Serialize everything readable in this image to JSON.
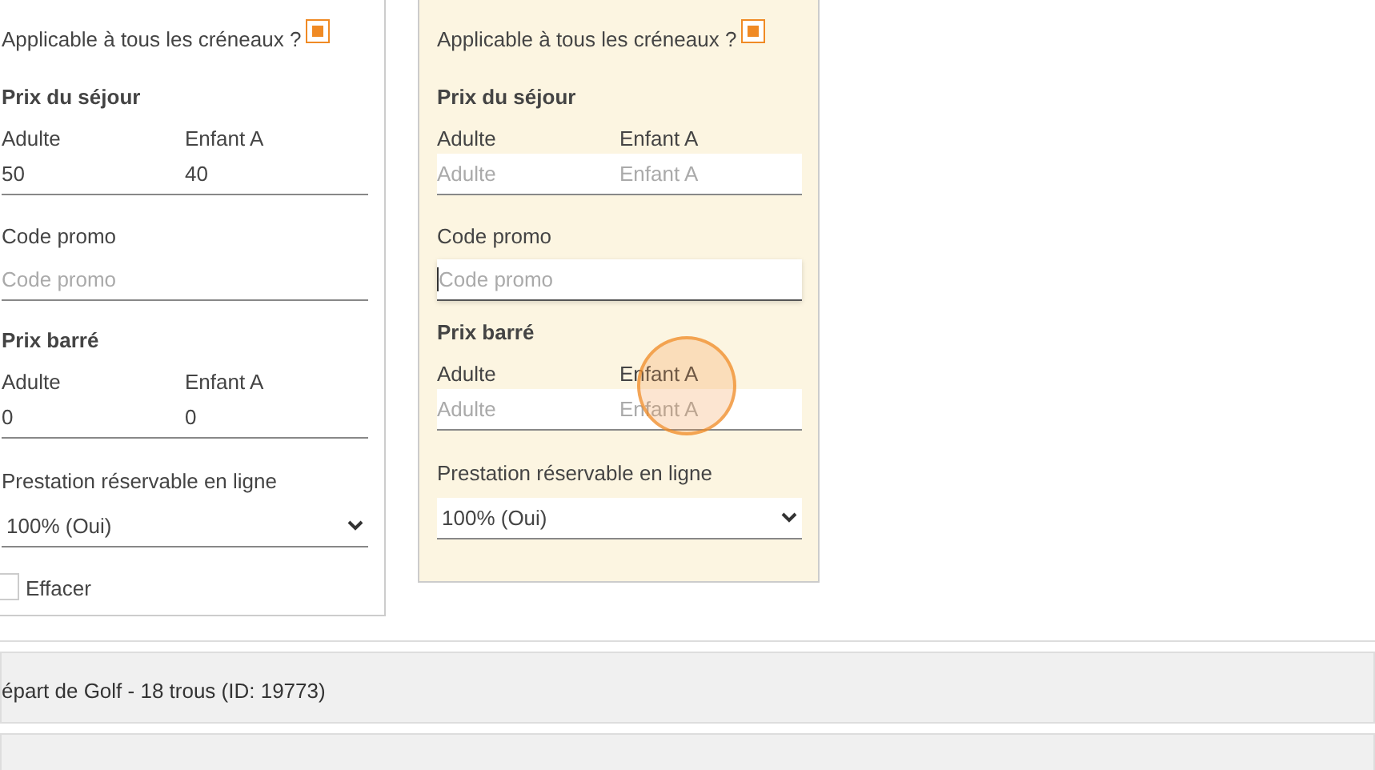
{
  "panels": [
    {
      "highlighted": false,
      "apply_all": {
        "label": "Applicable à tous les créneaux ?",
        "checked": true
      },
      "stay_price": {
        "title": "Prix du séjour",
        "fields": [
          {
            "label": "Adulte",
            "value": "50"
          },
          {
            "label": "Enfant A",
            "value": "40"
          }
        ]
      },
      "promo": {
        "label": "Code promo",
        "placeholder": "Code promo",
        "focused": false
      },
      "strike_price": {
        "title": "Prix barré",
        "fields": [
          {
            "label": "Adulte",
            "value": "0"
          },
          {
            "label": "Enfant A",
            "value": "0"
          }
        ]
      },
      "booking": {
        "label": "Prestation réservable en ligne",
        "value": "100% (Oui)"
      },
      "clear": {
        "label": "Effacer",
        "checked": false
      }
    },
    {
      "highlighted": true,
      "apply_all": {
        "label": "Applicable à tous les créneaux ?",
        "checked": true
      },
      "stay_price": {
        "title": "Prix du séjour",
        "fields": [
          {
            "label": "Adulte",
            "placeholder": "Adulte"
          },
          {
            "label": "Enfant A",
            "placeholder": "Enfant A"
          }
        ]
      },
      "promo": {
        "label": "Code promo",
        "placeholder": "Code promo",
        "focused": true
      },
      "strike_price": {
        "title": "Prix barré",
        "fields": [
          {
            "label": "Adulte",
            "placeholder": "Adulte"
          },
          {
            "label": "Enfant A",
            "placeholder": "Enfant A"
          }
        ]
      },
      "booking": {
        "label": "Prestation réservable en ligne",
        "value": "100% (Oui)"
      }
    }
  ],
  "accordion": [
    {
      "title": "épart de Golf - 18 trous (ID: 19773)"
    }
  ]
}
